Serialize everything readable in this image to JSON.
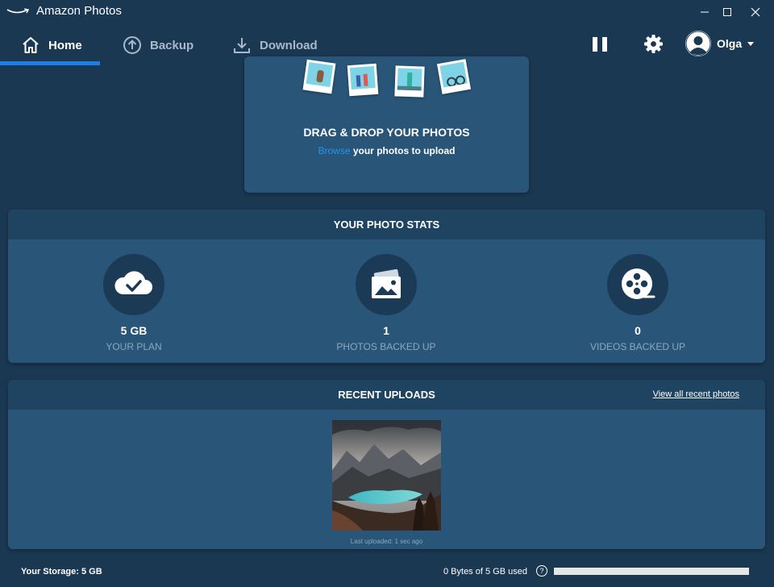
{
  "window": {
    "title": "Amazon Photos",
    "controls": [
      "minimize-icon",
      "maximize-icon",
      "close-icon"
    ]
  },
  "nav": {
    "tabs": [
      {
        "label": "Home",
        "icon": "home-icon",
        "active": true
      },
      {
        "label": "Backup",
        "icon": "upload-circle-icon",
        "active": false
      },
      {
        "label": "Download",
        "icon": "download-icon",
        "active": false
      }
    ],
    "actions": [
      "pause-icon",
      "gear-icon"
    ],
    "user": {
      "name": "Olga"
    }
  },
  "dropzone": {
    "title": "DRAG & DROP YOUR PHOTOS",
    "browse_link": "Browse",
    "subtitle": " your photos to upload"
  },
  "stats": {
    "title": "YOUR PHOTO STATS",
    "items": [
      {
        "value": "5 GB",
        "label": "YOUR PLAN",
        "icon": "cloud-check-icon"
      },
      {
        "value": "1",
        "label": "PHOTOS BACKED UP",
        "icon": "photos-icon"
      },
      {
        "value": "0",
        "label": "VIDEOS BACKED UP",
        "icon": "film-reel-icon"
      }
    ]
  },
  "recent": {
    "title": "RECENT UPLOADS",
    "view_all": "View all recent photos",
    "last_uploaded": "Last uploaded: 1 sec ago"
  },
  "footer": {
    "storage_label": "Your Storage: 5 GB",
    "usage_text": "0 Bytes of 5 GB used",
    "help": "?",
    "usage_fraction": 0.0
  },
  "colors": {
    "background": "#1b3853",
    "card": "#285578",
    "header": "#1e4461",
    "accent": "#1f7de6",
    "link": "#2196f3",
    "muted_text": "#8ea6bd"
  }
}
